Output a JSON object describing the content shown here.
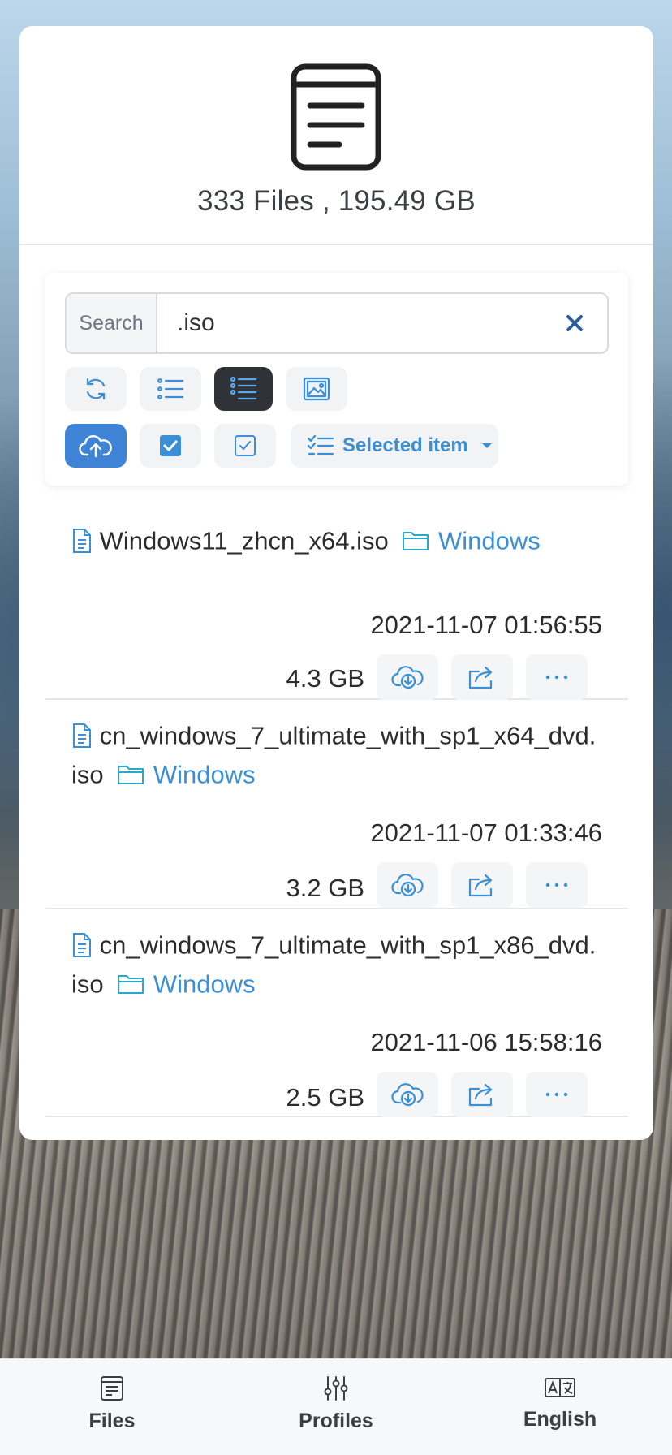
{
  "summary": "333 Files , 195.49 GB",
  "search": {
    "label": "Search",
    "value": ".iso"
  },
  "toolbar": {
    "view_modes": [
      "refresh-icon",
      "list-icon",
      "detail-list-icon",
      "image-icon"
    ],
    "active_view": "detail-list-icon",
    "selected_item_label": "Selected item"
  },
  "files": [
    {
      "name": "Windows11_zhcn_x64.iso",
      "folder": "Windows",
      "date": "2021-11-07 01:56:55",
      "size": "4.3 GB"
    },
    {
      "name_line1": "cn_windows_7_ultimate_with_sp1_x64_dvd.",
      "name_line2": "iso",
      "folder": "Windows",
      "date": "2021-11-07 01:33:46",
      "size": "3.2 GB"
    },
    {
      "name_line1": "cn_windows_7_ultimate_with_sp1_x86_dvd.",
      "name_line2": "iso",
      "folder": "Windows",
      "date": "2021-11-06 15:58:16",
      "size": "2.5 GB"
    }
  ],
  "nav": {
    "files": "Files",
    "profiles": "Profiles",
    "language": "English"
  },
  "colors": {
    "accent": "#3a8fd6",
    "primary_button": "#3f83d6",
    "dark_button": "#2f3338",
    "folder_icon": "#29a8c8"
  }
}
